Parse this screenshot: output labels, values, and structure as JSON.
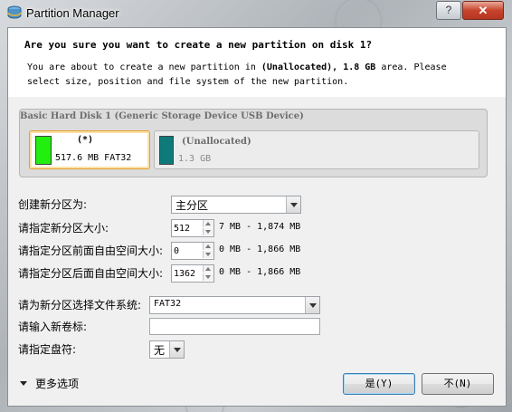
{
  "window": {
    "title": "Partition Manager",
    "help_label": "?",
    "close_label": "✕",
    "icon": "disk-app-icon"
  },
  "header": {
    "question": "Are you sure you want to create a new partition on disk 1?",
    "desc_prefix": "You are about to create a new partition in ",
    "desc_area": "(Unallocated), 1.8 GB",
    "desc_suffix": " area. Please select size, position and file system of the new partition."
  },
  "disk": {
    "title": "Basic Hard Disk 1 (Generic Storage Device USB Device)",
    "partitions": [
      {
        "name": "(*)",
        "size": "517.6 MB FAT32",
        "color": "#22ee10"
      },
      {
        "name": "(Unallocated)",
        "size": "1.3 GB",
        "color": "#0e7a7a"
      }
    ]
  },
  "form": {
    "type_label": "创建新分区为:",
    "type_value": "主分区",
    "size_label": "请指定新分区大小:",
    "size_value": "512",
    "size_range": "7 MB - 1,874 MB",
    "before_label": "请指定分区前面自由空间大小:",
    "before_value": "0",
    "before_range": "0 MB - 1,866 MB",
    "after_label": "请指定分区后面自由空间大小:",
    "after_value": "1362",
    "after_range": "0 MB - 1,866 MB",
    "fs_label": "请为新分区选择文件系统:",
    "fs_value": "FAT32",
    "volume_label": "请输入新卷标:",
    "volume_value": "",
    "drive_label": "请指定盘符:",
    "drive_value": "无"
  },
  "footer": {
    "more_options": "更多选项",
    "yes_label": "是(Y)",
    "no_label": "不(N)"
  }
}
